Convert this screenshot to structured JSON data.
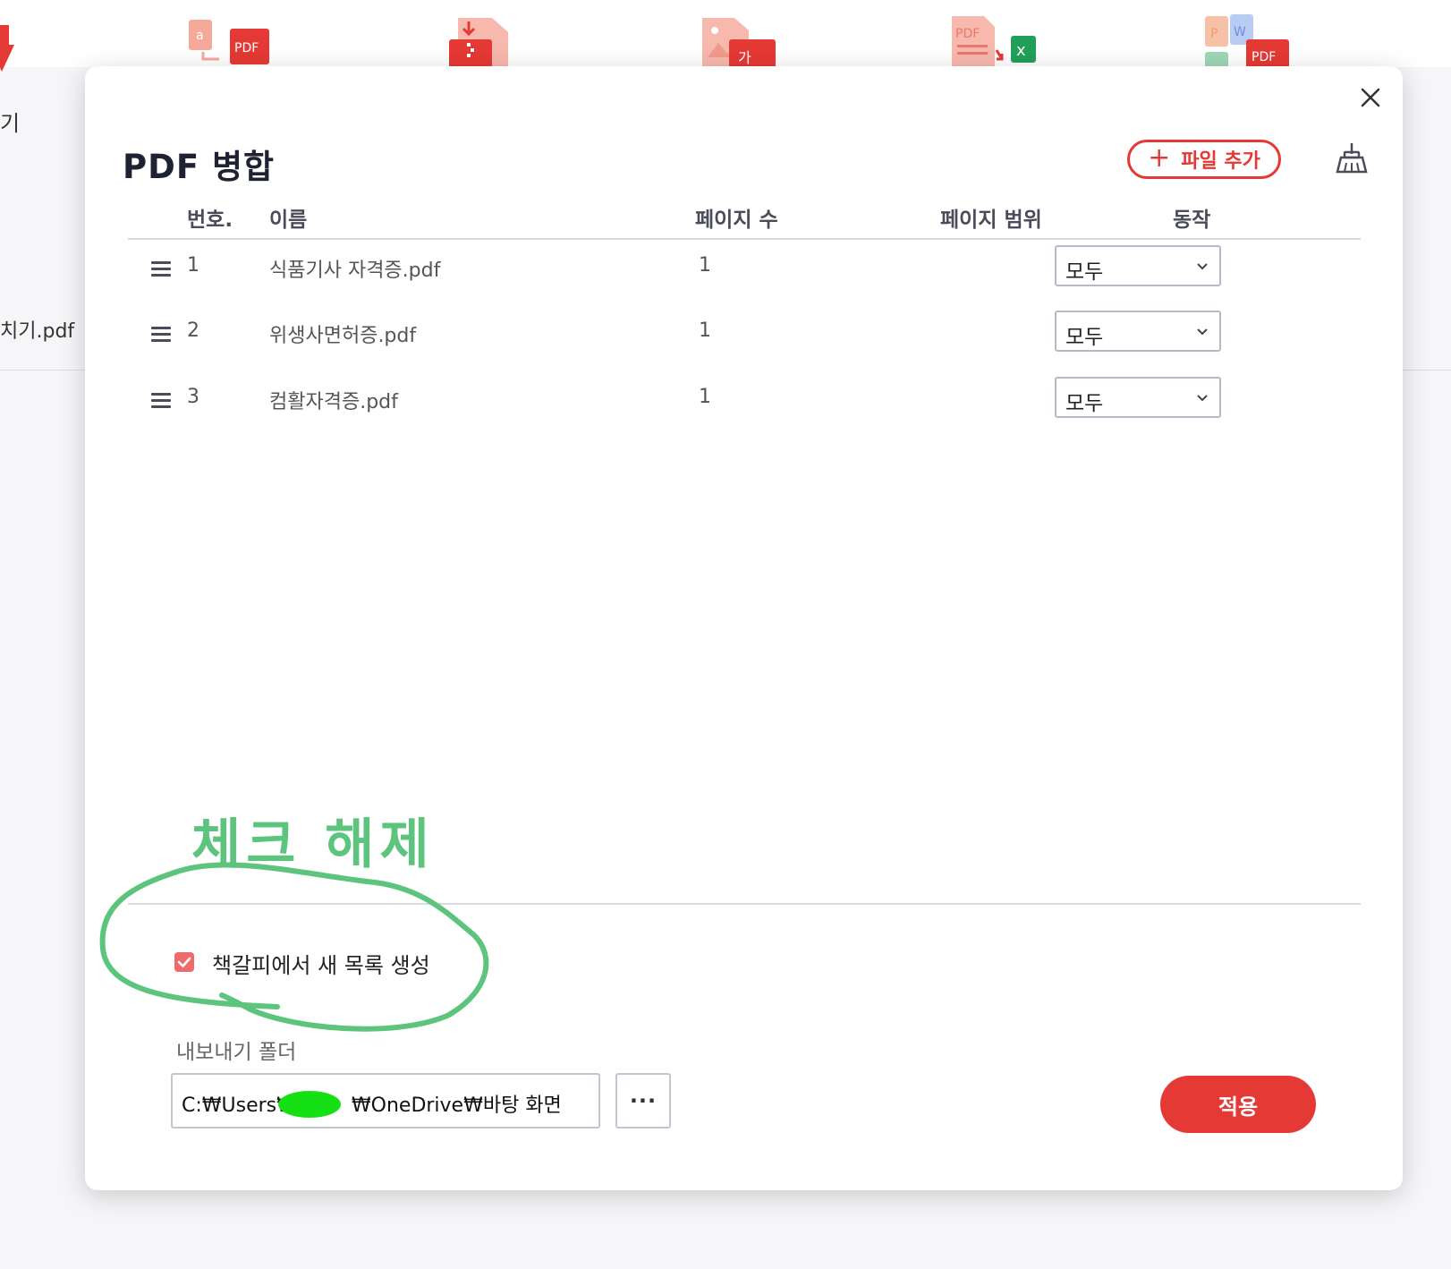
{
  "background": {
    "side_label_1": "기",
    "side_label_2": "치기.pdf",
    "tools": [
      {
        "name": "to-pdf-tool-icon"
      },
      {
        "name": "compress-pdf-tool-icon"
      },
      {
        "name": "image-to-text-tool-icon"
      },
      {
        "name": "pdf-to-excel-tool-icon"
      },
      {
        "name": "office-to-pdf-tool-icon"
      }
    ]
  },
  "dialog": {
    "title": "PDF 병합",
    "add_file_label": "파일 추가",
    "close_icon": "close-icon",
    "clear_icon": "broom-icon"
  },
  "table": {
    "headers": {
      "number": "번호.",
      "name": "이름",
      "pages": "페이지 수",
      "range": "페이지 범위",
      "action": "동작"
    },
    "rows": [
      {
        "no": "1",
        "name": "식품기사 자격증.pdf",
        "pages": "1",
        "range": "모두"
      },
      {
        "no": "2",
        "name": "위생사면허증.pdf",
        "pages": "1",
        "range": "모두"
      },
      {
        "no": "3",
        "name": "컴활자격증.pdf",
        "pages": "1",
        "range": "모두"
      }
    ]
  },
  "annotation": {
    "text": "체크 해제",
    "color": "#5cc47c"
  },
  "footer": {
    "bookmark_checkbox_label": "책갈피에서 새 목록 생성",
    "bookmark_checked": true,
    "export_folder_label": "내보내기 폴더",
    "path_prefix": "C:₩Users₩",
    "path_suffix": "₩OneDrive₩바탕 화면",
    "browse_label": "···",
    "apply_label": "적용"
  },
  "colors": {
    "accent": "#e53935",
    "checkbox": "#ef6b6b",
    "title": "#1f2233"
  }
}
